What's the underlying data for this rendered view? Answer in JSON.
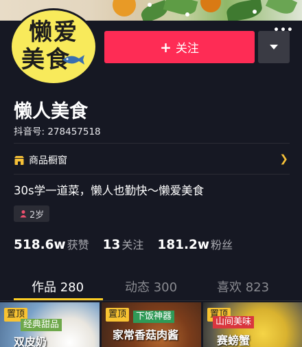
{
  "profile": {
    "avatar_text_line1": "懒爱",
    "avatar_text_line2": "美食",
    "nickname": "懒人美食",
    "douyin_id": "抖音号: 278457518",
    "bio": "30s学一道菜，懒人也勤快～懒爱美食",
    "age": "2岁"
  },
  "actions": {
    "follow_label": "关注",
    "follow_icon": "+"
  },
  "shop": {
    "label": "商品橱窗"
  },
  "stats": [
    {
      "value": "518.6w",
      "label": "获赞"
    },
    {
      "value": "13",
      "label": "关注"
    },
    {
      "value": "181.2w",
      "label": "粉丝"
    }
  ],
  "tabs": [
    {
      "label": "作品 280"
    },
    {
      "label": "动态 300"
    },
    {
      "label": "喜欢 823"
    }
  ],
  "videos": [
    {
      "pin": "置顶",
      "tag": "经典甜品",
      "caption": "双皮奶"
    },
    {
      "pin": "置顶",
      "tag": "下饭神器",
      "caption": "家常香菇肉酱"
    },
    {
      "pin": "置顶",
      "tag": "山间美味",
      "caption": "赛螃蟹"
    }
  ],
  "colors": {
    "background": "#161823",
    "follow_button": "#fe2c55",
    "accent_yellow": "#facc24",
    "avatar_bg": "#f8ea5b"
  }
}
